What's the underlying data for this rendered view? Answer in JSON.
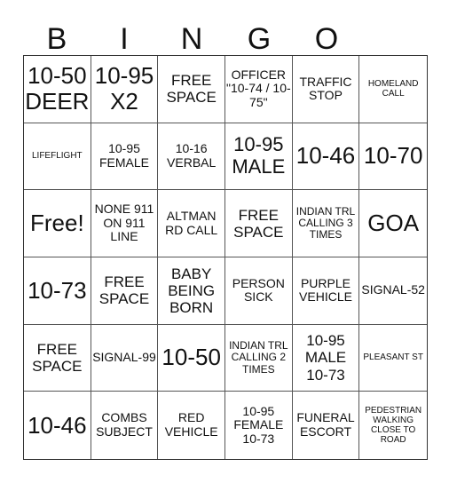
{
  "header": {
    "letters": [
      "B",
      "I",
      "N",
      "G",
      "O"
    ]
  },
  "grid": {
    "rows": [
      [
        "10-50 DEER",
        "10-95 X2",
        "FREE SPACE",
        "OFFICER \"10-74 / 10-75\"",
        "TRAFFIC STOP",
        "HOMELAND CALL"
      ],
      [
        "LIFEFLIGHT",
        "10-95 FEMALE",
        "10-16 VERBAL",
        "10-95 MALE",
        "10-46",
        "10-70"
      ],
      [
        "Free!",
        "NONE 911 ON 911 LINE",
        "ALTMAN RD CALL",
        "FREE SPACE",
        "INDIAN TRL CALLING 3 TIMES",
        "GOA"
      ],
      [
        "10-73",
        "FREE SPACE",
        "BABY BEING BORN",
        "PERSON SICK",
        "PURPLE VEHICLE",
        "SIGNAL-52"
      ],
      [
        "FREE SPACE",
        "SIGNAL-99",
        "10-50",
        "INDIAN TRL CALLING 2 TIMES",
        "10-95 MALE 10-73",
        "PLEASANT ST"
      ],
      [
        "10-46",
        "COMBS SUBJECT",
        "RED VEHICLE",
        "10-95 FEMALE 10-73",
        "FUNERAL ESCORT",
        "PEDESTRIAN WALKING CLOSE TO ROAD"
      ]
    ]
  }
}
